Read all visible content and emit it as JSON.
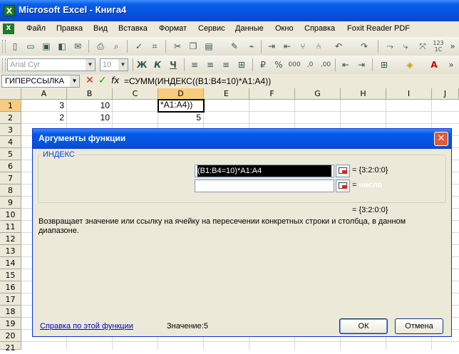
{
  "window": {
    "title": "Microsoft Excel - Книга4",
    "app_icon": "X"
  },
  "menu": [
    "Файл",
    "Правка",
    "Вид",
    "Вставка",
    "Формат",
    "Сервис",
    "Данные",
    "Окно",
    "Справка",
    "Foxit Reader PDF"
  ],
  "format_toolbar": {
    "font": "Arial Cyr",
    "size": "10",
    "bold": "Ж",
    "italic": "К",
    "underline": "Ч"
  },
  "formula_bar": {
    "name_box": "ГИПЕРССЫЛКА",
    "formula": "=СУММ(ИНДЕКС((B1:B4=10)*A1:A4))",
    "fx": "fx"
  },
  "columns": [
    "A",
    "B",
    "C",
    "D",
    "E",
    "F",
    "G",
    "H",
    "I",
    "J"
  ],
  "rows": [
    "1",
    "2",
    "3",
    "4",
    "5",
    "6",
    "7",
    "8",
    "9",
    "10",
    "11",
    "12",
    "13",
    "14",
    "15",
    "16",
    "17",
    "18",
    "19",
    "20",
    "21"
  ],
  "cells": {
    "A1": "3",
    "B1": "10",
    "D1": "*A1:A4))",
    "A2": "2",
    "B2": "10",
    "D2": "5"
  },
  "dialog": {
    "title": "Аргументы функции",
    "function_name": "ИНДЕКС",
    "arg1_value": "(B1:B4=10)*A1:A4",
    "arg1_result": "= {3:2:0:0}",
    "arg2_value": "",
    "arg2_result_prefix": "=",
    "arg2_result_hint": "число",
    "result": "= {3:2:0:0}",
    "description": "Возвращает значение или ссылку на ячейку на пересечении конкретных строки и столбца, в данном диапазоне.",
    "help_link": "Справка по этой функции",
    "value_label": "Значение:",
    "value": "5",
    "ok": "ОК",
    "cancel": "Отмена"
  }
}
